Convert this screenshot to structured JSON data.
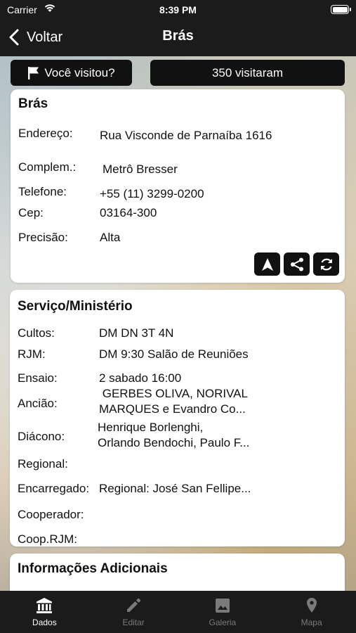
{
  "status": {
    "carrier": "Carrier",
    "time": "8:39 PM"
  },
  "nav": {
    "back_label": "Voltar",
    "title": "Brás"
  },
  "actions": {
    "visited_label": "Você visitou?",
    "visit_count": "350 visitaram"
  },
  "address_card": {
    "title": "Brás",
    "rows": [
      {
        "label": "Endereço:",
        "value": "Rua Visconde de Parnaíba 1616"
      },
      {
        "label": "Complem.:",
        "value": "Metrô Bresser"
      },
      {
        "label": "Telefone:",
        "value": "+55 (11) 3299-0200"
      },
      {
        "label": "Cep:",
        "value": "03164-300"
      },
      {
        "label": "Precisão:",
        "value": "Alta"
      }
    ],
    "icons": [
      "navigation-arrow-icon",
      "share-icon",
      "sync-icon"
    ]
  },
  "service_card": {
    "title": "Serviço/Ministério",
    "rows": [
      {
        "label": "Cultos:",
        "value": "DM DN 3T 4N"
      },
      {
        "label": "RJM:",
        "value": "DM 9:30 Salão de Reuniões"
      },
      {
        "label": "Ensaio:",
        "value": "2 sabado 16:00"
      },
      {
        "label": "Ancião:",
        "value_line1": " GERBES OLIVA, NORIVAL",
        "value_line2": "MARQUES e Evandro Co..."
      },
      {
        "label": "Diácono:",
        "value_line1": "Henrique Borlenghi,",
        "value_line2": "Orlando Bendochi, Paulo F..."
      },
      {
        "label": "Regional:",
        "value": ""
      },
      {
        "label": "Encarregado:",
        "value": "Regional: José San Fellipe..."
      },
      {
        "label": "Cooperador:",
        "value": ""
      },
      {
        "label": "Coop.RJM:",
        "value": ""
      }
    ]
  },
  "extra_card": {
    "title": "Informações Adicionais"
  },
  "tabbar": {
    "tabs": [
      {
        "label": "Dados",
        "icon": "bank-icon",
        "active": true
      },
      {
        "label": "Editar",
        "icon": "pencil-icon",
        "active": false
      },
      {
        "label": "Galeria",
        "icon": "image-icon",
        "active": false
      },
      {
        "label": "Mapa",
        "icon": "map-pin-icon",
        "active": false
      }
    ]
  }
}
